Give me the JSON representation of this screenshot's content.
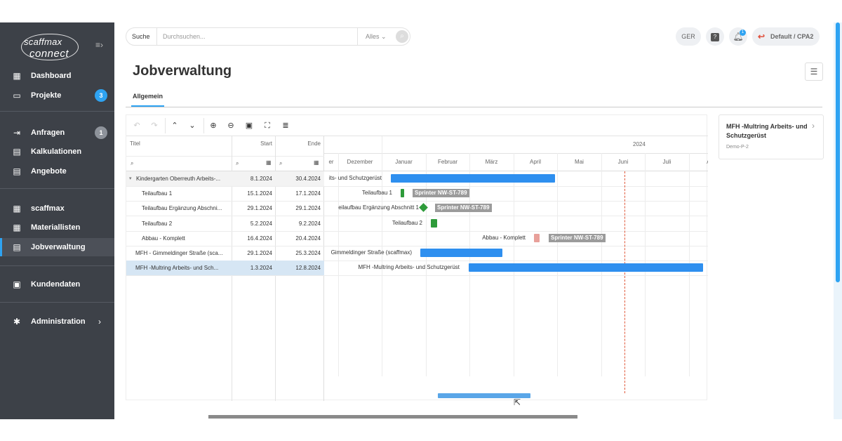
{
  "app": {
    "logo_top": "scaffmax",
    "logo_bottom": "connect"
  },
  "sidebar": {
    "items": [
      {
        "label": "Dashboard",
        "icon": "dashboard-icon"
      },
      {
        "label": "Projekte",
        "icon": "briefcase-icon",
        "badge": "3",
        "badge_color": "#2ea3f2"
      },
      {
        "label": "Anfragen",
        "icon": "inbox-icon",
        "badge": "1",
        "badge_color": "#8e939b"
      },
      {
        "label": "Kalkulationen",
        "icon": "calculator-icon"
      },
      {
        "label": "Angebote",
        "icon": "document-icon"
      },
      {
        "label": "scaffmax",
        "icon": "grid-icon"
      },
      {
        "label": "Materiallisten",
        "icon": "grid-icon"
      },
      {
        "label": "Jobverwaltung",
        "icon": "gantt-icon"
      },
      {
        "label": "Kundendaten",
        "icon": "contacts-icon"
      },
      {
        "label": "Administration",
        "icon": "gear-icon"
      }
    ]
  },
  "topbar": {
    "search_label": "Suche",
    "search_placeholder": "Durchsuchen...",
    "scope": "Alles",
    "language": "GER",
    "notification_count": "1",
    "profile": "Default / CPA2"
  },
  "page": {
    "title": "Jobverwaltung",
    "tab": "Allgemein"
  },
  "grid": {
    "headers": {
      "title": "Titel",
      "start": "Start",
      "end": "Ende"
    },
    "rows": [
      {
        "title": "Kindergarten Oberreuth Arbeits-...",
        "start": "8.1.2024",
        "end": "30.4.2024",
        "indent": 0,
        "expander": "▾"
      },
      {
        "title": "Teilaufbau 1",
        "start": "15.1.2024",
        "end": "17.1.2024",
        "indent": 1
      },
      {
        "title": "Teilaufbau Ergänzung Abschni...",
        "start": "29.1.2024",
        "end": "29.1.2024",
        "indent": 1
      },
      {
        "title": "Teilaufbau 2",
        "start": "5.2.2024",
        "end": "9.2.2024",
        "indent": 1
      },
      {
        "title": "Abbau - Komplett",
        "start": "16.4.2024",
        "end": "20.4.2024",
        "indent": 1
      },
      {
        "title": "MFH - Gimmeldinger Straße (sca...",
        "start": "29.1.2024",
        "end": "25.3.2024",
        "indent": 0
      },
      {
        "title": "MFH -Multring Arbeits- und Sch...",
        "start": "1.3.2024",
        "end": "12.8.2024",
        "indent": 0,
        "selected": true
      }
    ]
  },
  "chart": {
    "year": "2024",
    "months": [
      "er",
      "Dezember",
      "Januar",
      "Februar",
      "März",
      "April",
      "Mai",
      "Juni",
      "Juli",
      "Au"
    ],
    "labels": [
      "its- und Schutzgerüst",
      "Teilaufbau 1",
      "eilaufbau Ergänzung Abschnitt 1",
      "Teilaufbau 2",
      "Abbau - Komplett",
      "Gimmeldinger Straße (scaffmax)",
      "MFH -Multring Arbeits- und Schutzgerüst"
    ],
    "tags": [
      "Sprinter NW-ST-789",
      "Sprinter NW-ST-789",
      "Sprinter NW-ST-789"
    ],
    "colors": {
      "bar": "#2e8fef",
      "green": "#2e9b3a",
      "pink": "#e8a09a",
      "today": "#e05a3c"
    }
  },
  "card": {
    "title": "MFH -Multring Arbeits- und Schutzgerüst",
    "sub": "Demo-P-2"
  }
}
